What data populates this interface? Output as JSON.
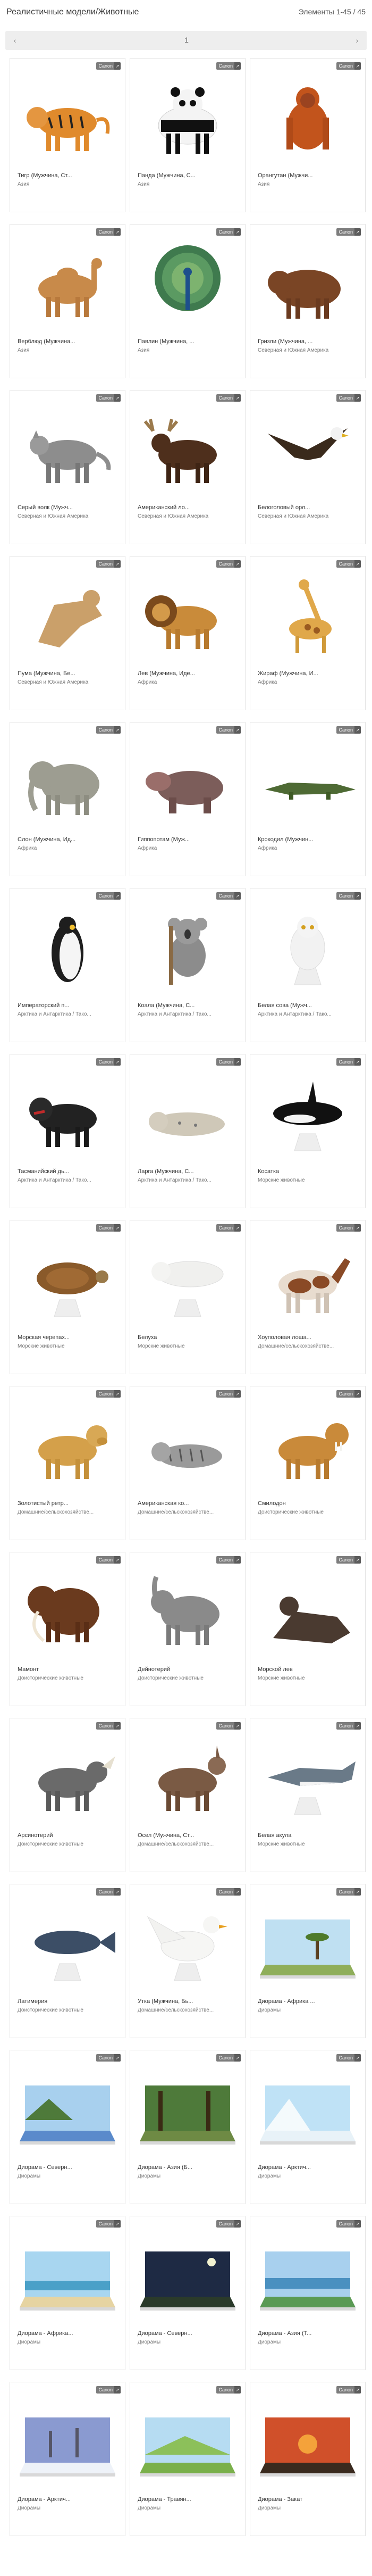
{
  "header": {
    "title": "Реалистичные модели/Животные",
    "count": "Элементы 1-45 / 45"
  },
  "pager": {
    "prev": "‹",
    "indicator": "1",
    "next": "›"
  },
  "badge": {
    "label": "Canon",
    "icon": "link-icon"
  },
  "colors": {
    "badge_bg": "#7d7d7d",
    "card_border": "#e3e3e3",
    "pager_bg": "#eeeeee"
  },
  "items": [
    {
      "name": "Тигр (Мужчина, Ст...",
      "category": "Азия",
      "picture": "tiger"
    },
    {
      "name": "Панда (Мужчина, С...",
      "category": "Азия",
      "picture": "panda"
    },
    {
      "name": "Орангутан (Мужчи...",
      "category": "Азия",
      "picture": "orangutan"
    },
    {
      "name": "Верблюд (Мужчина...",
      "category": "Азия",
      "picture": "camel"
    },
    {
      "name": "Павлин (Мужчина, ...",
      "category": "Азия",
      "picture": "peacock"
    },
    {
      "name": "Гризли (Мужчина, ...",
      "category": "Северная и Южная Америка",
      "picture": "grizzly"
    },
    {
      "name": "Серый волк (Мужч...",
      "category": "Северная и Южная Америка",
      "picture": "wolf"
    },
    {
      "name": "Американский ло...",
      "category": "Северная и Южная Америка",
      "picture": "moose"
    },
    {
      "name": "Белоголовый орл...",
      "category": "Северная и Южная Америка",
      "picture": "eagle"
    },
    {
      "name": "Пума (Мужчина, Бе...",
      "category": "Северная и Южная Америка",
      "picture": "puma"
    },
    {
      "name": "Лев (Мужчина, Иде...",
      "category": "Африка",
      "picture": "lion"
    },
    {
      "name": "Жираф (Мужчина, И...",
      "category": "Африка",
      "picture": "giraffe"
    },
    {
      "name": "Слон (Мужчина, Ид...",
      "category": "Африка",
      "picture": "elephant"
    },
    {
      "name": "Гиппопотам (Муж...",
      "category": "Африка",
      "picture": "hippo"
    },
    {
      "name": "Крокодил (Мужчин...",
      "category": "Африка",
      "picture": "crocodile"
    },
    {
      "name": "Императорский п...",
      "category": "Арктика и Антарктика / Тако...",
      "picture": "penguin"
    },
    {
      "name": "Коала (Мужчина, С...",
      "category": "Арктика и Антарктика / Тако...",
      "picture": "koala"
    },
    {
      "name": "Белая сова (Мужч...",
      "category": "Арктика и Антарктика / Тако...",
      "picture": "owl"
    },
    {
      "name": "Тасманийский дь...",
      "category": "Арктика и Антарктика / Тако...",
      "picture": "devil"
    },
    {
      "name": "Ларга (Мужчина, С...",
      "category": "Арктика и Антарктика / Тако...",
      "picture": "seal"
    },
    {
      "name": "Косатка",
      "category": "Морские животные",
      "picture": "orca"
    },
    {
      "name": "Морская черепах...",
      "category": "Морские животные",
      "picture": "turtle"
    },
    {
      "name": "Белуха",
      "category": "Морские животные",
      "picture": "beluga"
    },
    {
      "name": "Хоуполовая лоша...",
      "category": "Домашние/сельскохозяйстве...",
      "picture": "horse"
    },
    {
      "name": "Золотистый ретр...",
      "category": "Домашние/сельскохозяйстве...",
      "picture": "retriever"
    },
    {
      "name": "Американская ко...",
      "category": "Домашние/сельскохозяйстве...",
      "picture": "cat"
    },
    {
      "name": "Смилодон",
      "category": "Доисторические животные",
      "picture": "smilodon"
    },
    {
      "name": "Мамонт",
      "category": "Доисторические животные",
      "picture": "mammoth"
    },
    {
      "name": "Дейнотерий",
      "category": "Доисторические животные",
      "picture": "deinotherium"
    },
    {
      "name": "Морской лев",
      "category": "Морские животные",
      "picture": "sealion"
    },
    {
      "name": "Арсинотерий",
      "category": "Доисторические животные",
      "picture": "arsinoitherium"
    },
    {
      "name": "Осел (Мужчина, Ст...",
      "category": "Домашние/сельскохозяйстве...",
      "picture": "donkey"
    },
    {
      "name": "Белая акула",
      "category": "Морские животные",
      "picture": "shark"
    },
    {
      "name": "Латимерия",
      "category": "Доисторические животные",
      "picture": "coelacanth"
    },
    {
      "name": "Утка (Мужчина, Бь...",
      "category": "Домашние/сельскохозяйстве...",
      "picture": "duck"
    },
    {
      "name": "Диорама - Африка ...",
      "category": "Диорамы",
      "picture": "diorama-savanna"
    },
    {
      "name": "Диорама - Северн...",
      "category": "Диорамы",
      "picture": "diorama-lake"
    },
    {
      "name": "Диорама - Азия (Б...",
      "category": "Диорамы",
      "picture": "diorama-forest"
    },
    {
      "name": "Диорама - Арктич...",
      "category": "Диорамы",
      "picture": "diorama-arctic"
    },
    {
      "name": "Диорама - Африка...",
      "category": "Диорамы",
      "picture": "diorama-beach"
    },
    {
      "name": "Диорама - Северн...",
      "category": "Диорамы",
      "picture": "diorama-night"
    },
    {
      "name": "Диорама - Азия (Т...",
      "category": "Диорамы",
      "picture": "diorama-tropic"
    },
    {
      "name": "Диорама - Арктич...",
      "category": "Диорамы",
      "picture": "diorama-snow"
    },
    {
      "name": "Диорама - Травян...",
      "category": "Диорамы",
      "picture": "diorama-grass"
    },
    {
      "name": "Диорама - Закат",
      "category": "Диорамы",
      "picture": "diorama-sunset"
    }
  ]
}
